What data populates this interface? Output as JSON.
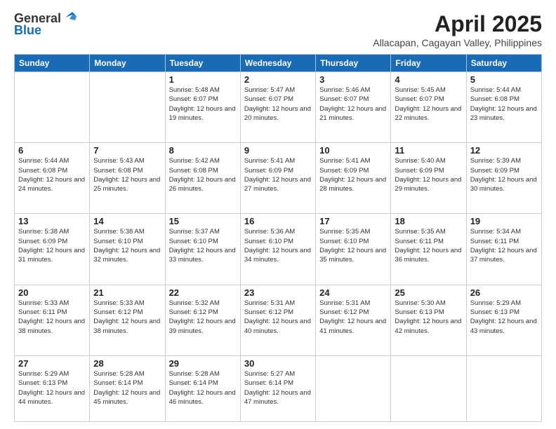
{
  "header": {
    "logo_general": "General",
    "logo_blue": "Blue",
    "month_title": "April 2025",
    "subtitle": "Allacapan, Cagayan Valley, Philippines"
  },
  "weekdays": [
    "Sunday",
    "Monday",
    "Tuesday",
    "Wednesday",
    "Thursday",
    "Friday",
    "Saturday"
  ],
  "weeks": [
    [
      {
        "day": "",
        "sunrise": "",
        "sunset": "",
        "daylight": ""
      },
      {
        "day": "",
        "sunrise": "",
        "sunset": "",
        "daylight": ""
      },
      {
        "day": "1",
        "sunrise": "Sunrise: 5:48 AM",
        "sunset": "Sunset: 6:07 PM",
        "daylight": "Daylight: 12 hours and 19 minutes."
      },
      {
        "day": "2",
        "sunrise": "Sunrise: 5:47 AM",
        "sunset": "Sunset: 6:07 PM",
        "daylight": "Daylight: 12 hours and 20 minutes."
      },
      {
        "day": "3",
        "sunrise": "Sunrise: 5:46 AM",
        "sunset": "Sunset: 6:07 PM",
        "daylight": "Daylight: 12 hours and 21 minutes."
      },
      {
        "day": "4",
        "sunrise": "Sunrise: 5:45 AM",
        "sunset": "Sunset: 6:07 PM",
        "daylight": "Daylight: 12 hours and 22 minutes."
      },
      {
        "day": "5",
        "sunrise": "Sunrise: 5:44 AM",
        "sunset": "Sunset: 6:08 PM",
        "daylight": "Daylight: 12 hours and 23 minutes."
      }
    ],
    [
      {
        "day": "6",
        "sunrise": "Sunrise: 5:44 AM",
        "sunset": "Sunset: 6:08 PM",
        "daylight": "Daylight: 12 hours and 24 minutes."
      },
      {
        "day": "7",
        "sunrise": "Sunrise: 5:43 AM",
        "sunset": "Sunset: 6:08 PM",
        "daylight": "Daylight: 12 hours and 25 minutes."
      },
      {
        "day": "8",
        "sunrise": "Sunrise: 5:42 AM",
        "sunset": "Sunset: 6:08 PM",
        "daylight": "Daylight: 12 hours and 26 minutes."
      },
      {
        "day": "9",
        "sunrise": "Sunrise: 5:41 AM",
        "sunset": "Sunset: 6:09 PM",
        "daylight": "Daylight: 12 hours and 27 minutes."
      },
      {
        "day": "10",
        "sunrise": "Sunrise: 5:41 AM",
        "sunset": "Sunset: 6:09 PM",
        "daylight": "Daylight: 12 hours and 28 minutes."
      },
      {
        "day": "11",
        "sunrise": "Sunrise: 5:40 AM",
        "sunset": "Sunset: 6:09 PM",
        "daylight": "Daylight: 12 hours and 29 minutes."
      },
      {
        "day": "12",
        "sunrise": "Sunrise: 5:39 AM",
        "sunset": "Sunset: 6:09 PM",
        "daylight": "Daylight: 12 hours and 30 minutes."
      }
    ],
    [
      {
        "day": "13",
        "sunrise": "Sunrise: 5:38 AM",
        "sunset": "Sunset: 6:09 PM",
        "daylight": "Daylight: 12 hours and 31 minutes."
      },
      {
        "day": "14",
        "sunrise": "Sunrise: 5:38 AM",
        "sunset": "Sunset: 6:10 PM",
        "daylight": "Daylight: 12 hours and 32 minutes."
      },
      {
        "day": "15",
        "sunrise": "Sunrise: 5:37 AM",
        "sunset": "Sunset: 6:10 PM",
        "daylight": "Daylight: 12 hours and 33 minutes."
      },
      {
        "day": "16",
        "sunrise": "Sunrise: 5:36 AM",
        "sunset": "Sunset: 6:10 PM",
        "daylight": "Daylight: 12 hours and 34 minutes."
      },
      {
        "day": "17",
        "sunrise": "Sunrise: 5:35 AM",
        "sunset": "Sunset: 6:10 PM",
        "daylight": "Daylight: 12 hours and 35 minutes."
      },
      {
        "day": "18",
        "sunrise": "Sunrise: 5:35 AM",
        "sunset": "Sunset: 6:11 PM",
        "daylight": "Daylight: 12 hours and 36 minutes."
      },
      {
        "day": "19",
        "sunrise": "Sunrise: 5:34 AM",
        "sunset": "Sunset: 6:11 PM",
        "daylight": "Daylight: 12 hours and 37 minutes."
      }
    ],
    [
      {
        "day": "20",
        "sunrise": "Sunrise: 5:33 AM",
        "sunset": "Sunset: 6:11 PM",
        "daylight": "Daylight: 12 hours and 38 minutes."
      },
      {
        "day": "21",
        "sunrise": "Sunrise: 5:33 AM",
        "sunset": "Sunset: 6:12 PM",
        "daylight": "Daylight: 12 hours and 38 minutes."
      },
      {
        "day": "22",
        "sunrise": "Sunrise: 5:32 AM",
        "sunset": "Sunset: 6:12 PM",
        "daylight": "Daylight: 12 hours and 39 minutes."
      },
      {
        "day": "23",
        "sunrise": "Sunrise: 5:31 AM",
        "sunset": "Sunset: 6:12 PM",
        "daylight": "Daylight: 12 hours and 40 minutes."
      },
      {
        "day": "24",
        "sunrise": "Sunrise: 5:31 AM",
        "sunset": "Sunset: 6:12 PM",
        "daylight": "Daylight: 12 hours and 41 minutes."
      },
      {
        "day": "25",
        "sunrise": "Sunrise: 5:30 AM",
        "sunset": "Sunset: 6:13 PM",
        "daylight": "Daylight: 12 hours and 42 minutes."
      },
      {
        "day": "26",
        "sunrise": "Sunrise: 5:29 AM",
        "sunset": "Sunset: 6:13 PM",
        "daylight": "Daylight: 12 hours and 43 minutes."
      }
    ],
    [
      {
        "day": "27",
        "sunrise": "Sunrise: 5:29 AM",
        "sunset": "Sunset: 6:13 PM",
        "daylight": "Daylight: 12 hours and 44 minutes."
      },
      {
        "day": "28",
        "sunrise": "Sunrise: 5:28 AM",
        "sunset": "Sunset: 6:14 PM",
        "daylight": "Daylight: 12 hours and 45 minutes."
      },
      {
        "day": "29",
        "sunrise": "Sunrise: 5:28 AM",
        "sunset": "Sunset: 6:14 PM",
        "daylight": "Daylight: 12 hours and 46 minutes."
      },
      {
        "day": "30",
        "sunrise": "Sunrise: 5:27 AM",
        "sunset": "Sunset: 6:14 PM",
        "daylight": "Daylight: 12 hours and 47 minutes."
      },
      {
        "day": "",
        "sunrise": "",
        "sunset": "",
        "daylight": ""
      },
      {
        "day": "",
        "sunrise": "",
        "sunset": "",
        "daylight": ""
      },
      {
        "day": "",
        "sunrise": "",
        "sunset": "",
        "daylight": ""
      }
    ]
  ]
}
